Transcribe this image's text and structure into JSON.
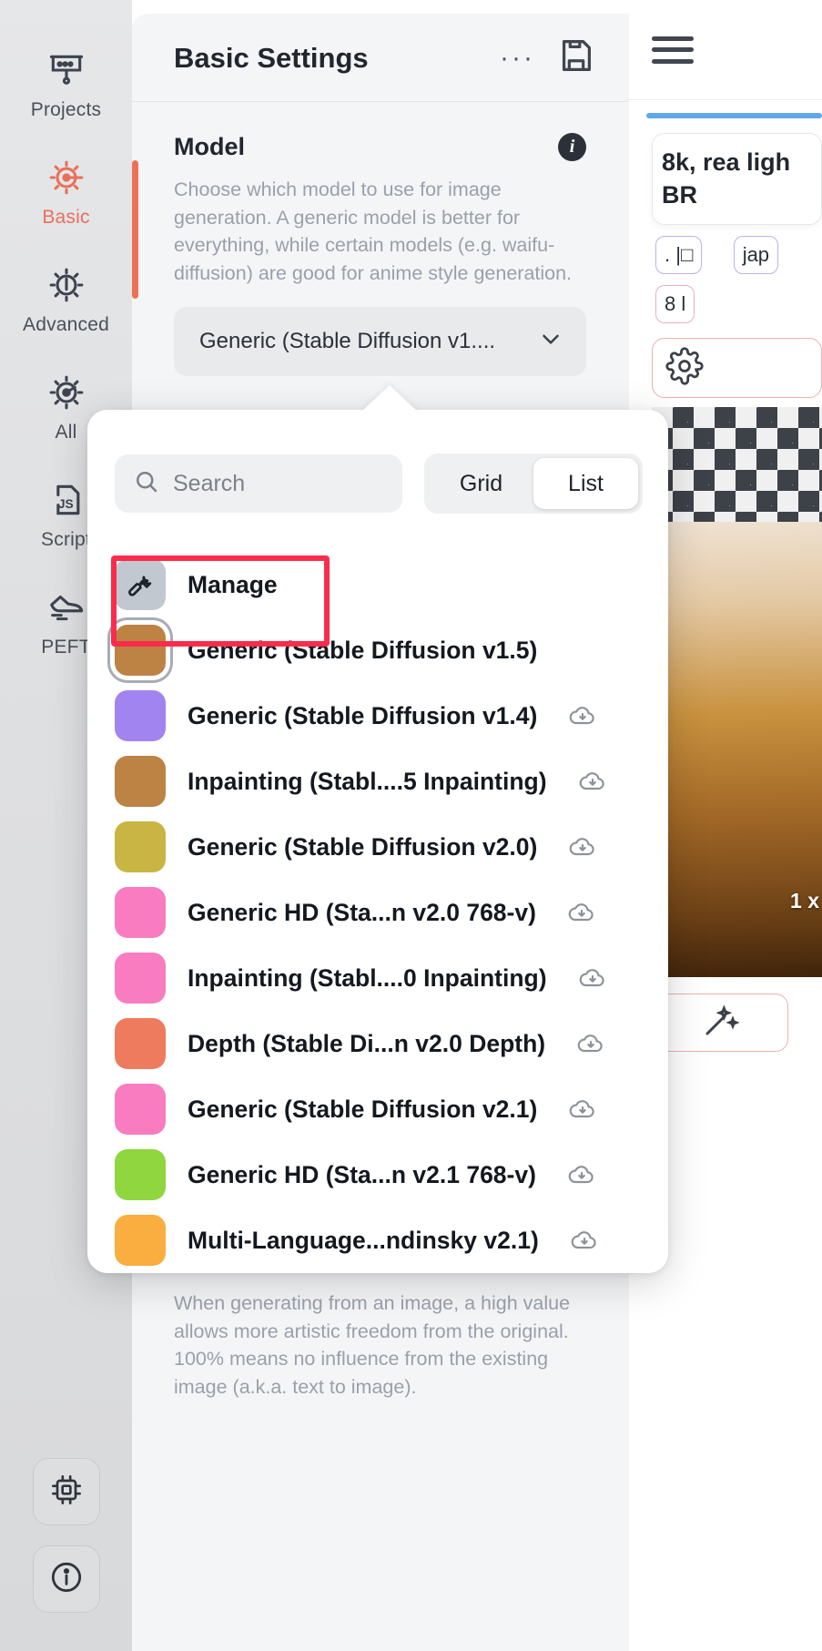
{
  "sidebar": {
    "items": [
      {
        "label": "Projects",
        "icon": "presentation-icon",
        "active": false
      },
      {
        "label": "Basic",
        "icon": "sun-settings-icon",
        "active": true
      },
      {
        "label": "Advanced",
        "icon": "sun-advanced-icon",
        "active": false
      },
      {
        "label": "All",
        "icon": "sun-all-icon",
        "active": false
      },
      {
        "label": "Script",
        "icon": "js-file-icon",
        "active": false
      },
      {
        "label": "PEFT",
        "icon": "shoe-icon",
        "active": false
      }
    ],
    "bottom_buttons": [
      {
        "name": "chip-icon"
      },
      {
        "name": "info-circle-icon"
      }
    ]
  },
  "panel": {
    "title": "Basic Settings",
    "more_label": "···",
    "save_icon": "floppy-save-icon",
    "section": {
      "title": "Model",
      "info_label": "i",
      "description": "Choose which model to use for image generation. A generic model is better for everything, while certain models (e.g. waifu-diffusion) are good for anime style generation.",
      "selected_value": "Generic (Stable Diffusion v1....",
      "chevron": "chevron-down-icon"
    },
    "lower_description": "When generating from an image, a high value allows more artistic freedom from the original. 100% means no influence from the existing image (a.k.a. text to image)."
  },
  "dropdown": {
    "search": {
      "placeholder": "Search",
      "value": "",
      "icon": "search-icon"
    },
    "view_toggle": {
      "options": [
        {
          "label": "Grid",
          "selected": false
        },
        {
          "label": "List",
          "selected": true
        }
      ]
    },
    "manage": {
      "label": "Manage",
      "icon": "wrench-icon",
      "highlighted": true
    },
    "models": [
      {
        "label": "Generic (Stable Diffusion v1.5)",
        "color": "#bd8344",
        "downloaded": true,
        "selected": true
      },
      {
        "label": "Generic (Stable Diffusion v1.4)",
        "color": "#a284f0",
        "downloaded": false,
        "selected": false
      },
      {
        "label": "Inpainting (Stabl....5 Inpainting)",
        "color": "#bd8344",
        "downloaded": false,
        "selected": false
      },
      {
        "label": "Generic (Stable Diffusion v2.0)",
        "color": "#c9b544",
        "downloaded": false,
        "selected": false
      },
      {
        "label": "Generic HD (Sta...n v2.0 768-v)",
        "color": "#f97cc0",
        "downloaded": false,
        "selected": false
      },
      {
        "label": "Inpainting (Stabl....0 Inpainting)",
        "color": "#f97cc0",
        "downloaded": false,
        "selected": false
      },
      {
        "label": "Depth (Stable Di...n v2.0 Depth)",
        "color": "#ef7b5e",
        "downloaded": false,
        "selected": false
      },
      {
        "label": "Generic (Stable Diffusion v2.1)",
        "color": "#f97cc0",
        "downloaded": false,
        "selected": false
      },
      {
        "label": "Generic HD (Sta...n v2.1 768-v)",
        "color": "#8fd63f",
        "downloaded": false,
        "selected": false
      },
      {
        "label": "Multi-Language...ndinsky v2.1)",
        "color": "#f9ae3f",
        "downloaded": false,
        "selected": false
      }
    ],
    "download_icon": "cloud-download-icon"
  },
  "right_panel": {
    "menu_icon": "hamburger-menu-icon",
    "prompt_lines": "8k, rea ligh BR",
    "chips": [
      {
        "label": ". |□"
      },
      {
        "label": "jap"
      },
      {
        "label": "8 l"
      }
    ],
    "gear_icon": "gear-icon",
    "image_badge": "1 x",
    "wand_icon": "magic-wand-icon"
  },
  "colors": {
    "accent": "#ef7155",
    "highlight_box": "#fb2c4b",
    "active_nav": "#e8705a"
  }
}
